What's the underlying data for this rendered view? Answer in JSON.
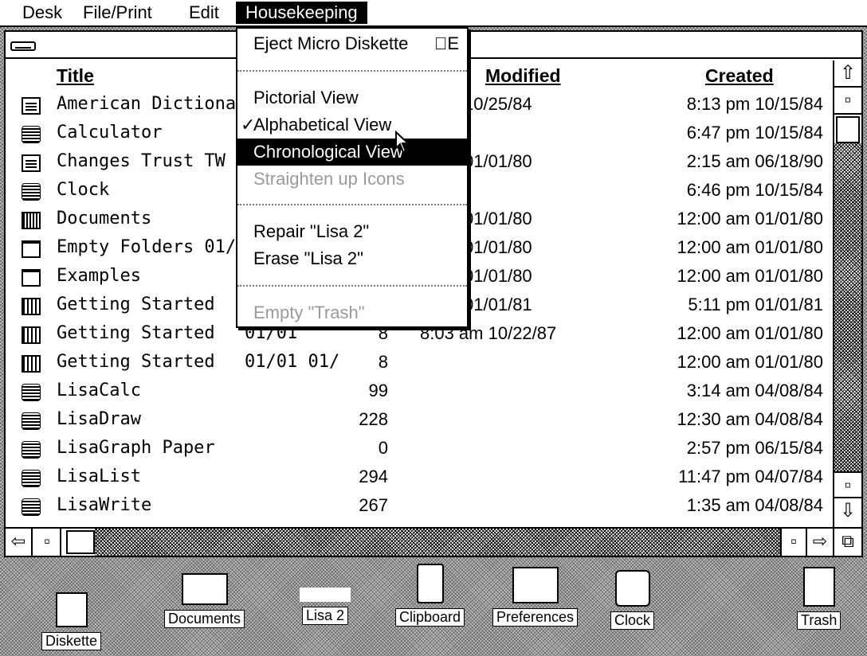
{
  "menubar": {
    "items": [
      "Desk",
      "File/Print",
      "Edit",
      "Housekeeping"
    ],
    "active": "Housekeeping"
  },
  "columns": {
    "title": "Title",
    "modified": "Modified",
    "created": "Created"
  },
  "rows": [
    {
      "title": "American Dictiona",
      "date": "",
      "size": "",
      "modified": "6 am 10/25/84",
      "created": "8:13 pm 10/15/84",
      "icon": "document-icon"
    },
    {
      "title": "Calculator",
      "date": "",
      "size": "",
      "modified": "",
      "created": "6:47 pm 10/15/84",
      "icon": "tool-icon"
    },
    {
      "title": "Changes Trust TW",
      "date": "",
      "size": "",
      "modified": "0 am 01/01/80",
      "created": "2:15 am 06/18/90",
      "icon": "document-icon"
    },
    {
      "title": "Clock",
      "date": "",
      "size": "",
      "modified": "",
      "created": "6:46 pm 10/15/84",
      "icon": "tool-icon"
    },
    {
      "title": "Documents",
      "date": "",
      "size": "",
      "modified": "0 am 01/01/80",
      "created": "12:00 am 01/01/80",
      "icon": "folder-filled-icon"
    },
    {
      "title": "Empty Folders 01/",
      "date": "",
      "size": "",
      "modified": "0 am 01/01/80",
      "created": "12:00 am 01/01/80",
      "icon": "folder-icon"
    },
    {
      "title": "Examples",
      "date": "",
      "size": "",
      "modified": "0 am 01/01/80",
      "created": "12:00 am 01/01/80",
      "icon": "folder-icon"
    },
    {
      "title": "Getting Started",
      "date": "",
      "size": "",
      "modified": "2 pm 01/01/81",
      "created": "5:11 pm 01/01/81",
      "icon": "stack-icon"
    },
    {
      "title": "Getting Started",
      "date": "01/01",
      "size": "8",
      "modified": "8:03 am 10/22/87",
      "created": "12:00 am 01/01/80",
      "icon": "stack-icon"
    },
    {
      "title": "Getting Started",
      "date": "01/01 01/",
      "size": "8",
      "modified": "",
      "created": "12:00 am 01/01/80",
      "icon": "stack-icon"
    },
    {
      "title": "LisaCalc",
      "date": "",
      "size": "99",
      "modified": "",
      "created": "3:14 am 04/08/84",
      "icon": "tool-icon"
    },
    {
      "title": "LisaDraw",
      "date": "",
      "size": "228",
      "modified": "",
      "created": "12:30 am 04/08/84",
      "icon": "tool-icon"
    },
    {
      "title": "LisaGraph Paper",
      "date": "",
      "size": "0",
      "modified": "",
      "created": "2:57 pm 06/15/84",
      "icon": "tool-icon"
    },
    {
      "title": "LisaList",
      "date": "",
      "size": "294",
      "modified": "",
      "created": "11:47 pm 04/07/84",
      "icon": "tool-icon"
    },
    {
      "title": "LisaWrite",
      "date": "",
      "size": "267",
      "modified": "",
      "created": "1:35 am 04/08/84",
      "icon": "tool-icon"
    }
  ],
  "dropdown": {
    "eject": "Eject Micro Diskette",
    "eject_shortcut": "E",
    "pictorial": "Pictorial View",
    "alphabetical": "Alphabetical View",
    "chronological": "Chronological View",
    "straighten": "Straighten up Icons",
    "repair": "Repair \"Lisa 2\"",
    "erase": "Erase \"Lisa 2\"",
    "empty_trash": "Empty \"Trash\""
  },
  "desktop_icons": {
    "diskette": "Diskette",
    "documents": "Documents",
    "lisa2": "Lisa 2",
    "clipboard": "Clipboard",
    "preferences": "Preferences",
    "clock": "Clock",
    "trash": "Trash"
  }
}
